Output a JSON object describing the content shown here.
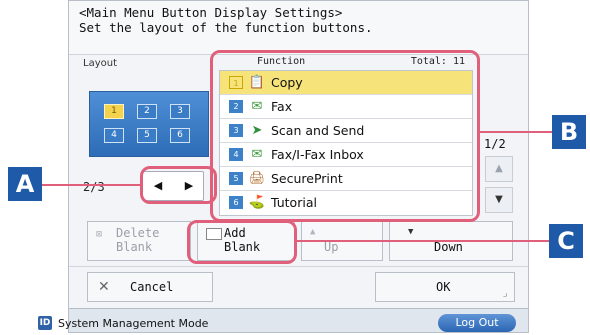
{
  "header": {
    "line1": "<Main Menu Button Display Settings>",
    "line2": "Set the layout of the function buttons."
  },
  "layout": {
    "label": "Layout",
    "preview_cells": [
      "1",
      "2",
      "3",
      "4",
      "5",
      "6"
    ],
    "selected_cell": "1",
    "page_indicator": "2/3",
    "prev_icon": "triangle-left-icon",
    "next_icon": "triangle-right-icon"
  },
  "function_list": {
    "header_label": "Function",
    "total_label": "Total: 11",
    "items": [
      {
        "num": "1",
        "label": "Copy",
        "icon": "copy-icon",
        "selected": true
      },
      {
        "num": "2",
        "label": "Fax",
        "icon": "fax-icon",
        "selected": false
      },
      {
        "num": "3",
        "label": "Scan and Send",
        "icon": "scan-send-icon",
        "selected": false
      },
      {
        "num": "4",
        "label": "Fax/I-Fax Inbox",
        "icon": "fax-inbox-icon",
        "selected": false
      },
      {
        "num": "5",
        "label": "SecurePrint",
        "icon": "secure-print-icon",
        "selected": false
      },
      {
        "num": "6",
        "label": "Tutorial",
        "icon": "tutorial-icon",
        "selected": false
      }
    ],
    "page_indicator": "1/2"
  },
  "buttons": {
    "delete_blank": "Delete\nBlank",
    "add_blank": "Add\nBlank",
    "up": "Up",
    "down": "Down",
    "cancel": "Cancel",
    "ok": "OK"
  },
  "status": {
    "mode_text": "System Management Mode",
    "logout": "Log Out"
  },
  "callouts": {
    "a": "A",
    "b": "B",
    "c": "C"
  },
  "colors": {
    "callout_bg": "#1e5aa8",
    "highlight": "#e0607b",
    "selected_row": "#f6e47a"
  }
}
